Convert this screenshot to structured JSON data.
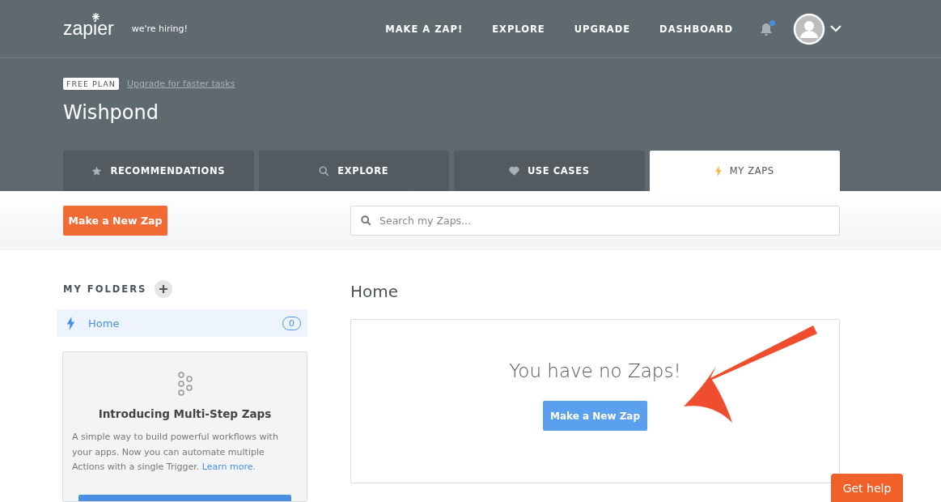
{
  "header": {
    "logo": "zapier",
    "hiring": "we're hiring!",
    "nav": [
      "MAKE A ZAP!",
      "EXPLORE",
      "UPGRADE",
      "DASHBOARD"
    ],
    "notifications_unread": true
  },
  "plan": {
    "badge": "FREE PLAN",
    "upgrade_link": "Upgrade for faster tasks",
    "account": "Wishpond"
  },
  "tabs": [
    {
      "label": "RECOMMENDATIONS",
      "kind": "star",
      "selected": false
    },
    {
      "label": "EXPLORE",
      "kind": "search",
      "selected": false
    },
    {
      "label": "USE CASES",
      "kind": "heart",
      "selected": false
    },
    {
      "label": "MY ZAPS",
      "kind": "bolt",
      "selected": true
    }
  ],
  "toolbar": {
    "new_zap_button": "Make a New Zap",
    "search": {
      "placeholder": "Search my Zaps..."
    }
  },
  "sidebar": {
    "title": "MY FOLDERS",
    "folders": [
      {
        "name": "Home",
        "count": "0",
        "selected": true
      }
    ],
    "promo": {
      "title": "Introducing Multi-Step Zaps",
      "text": "A simple way to build powerful workflows with your apps. Now you can automate multiple Actions with a single Trigger.",
      "link": "Learn more",
      "after_link": "."
    }
  },
  "main": {
    "title": "Home",
    "empty_message": "You have no Zaps!",
    "button": "Make a New Zap"
  },
  "help_button": "Get help"
}
